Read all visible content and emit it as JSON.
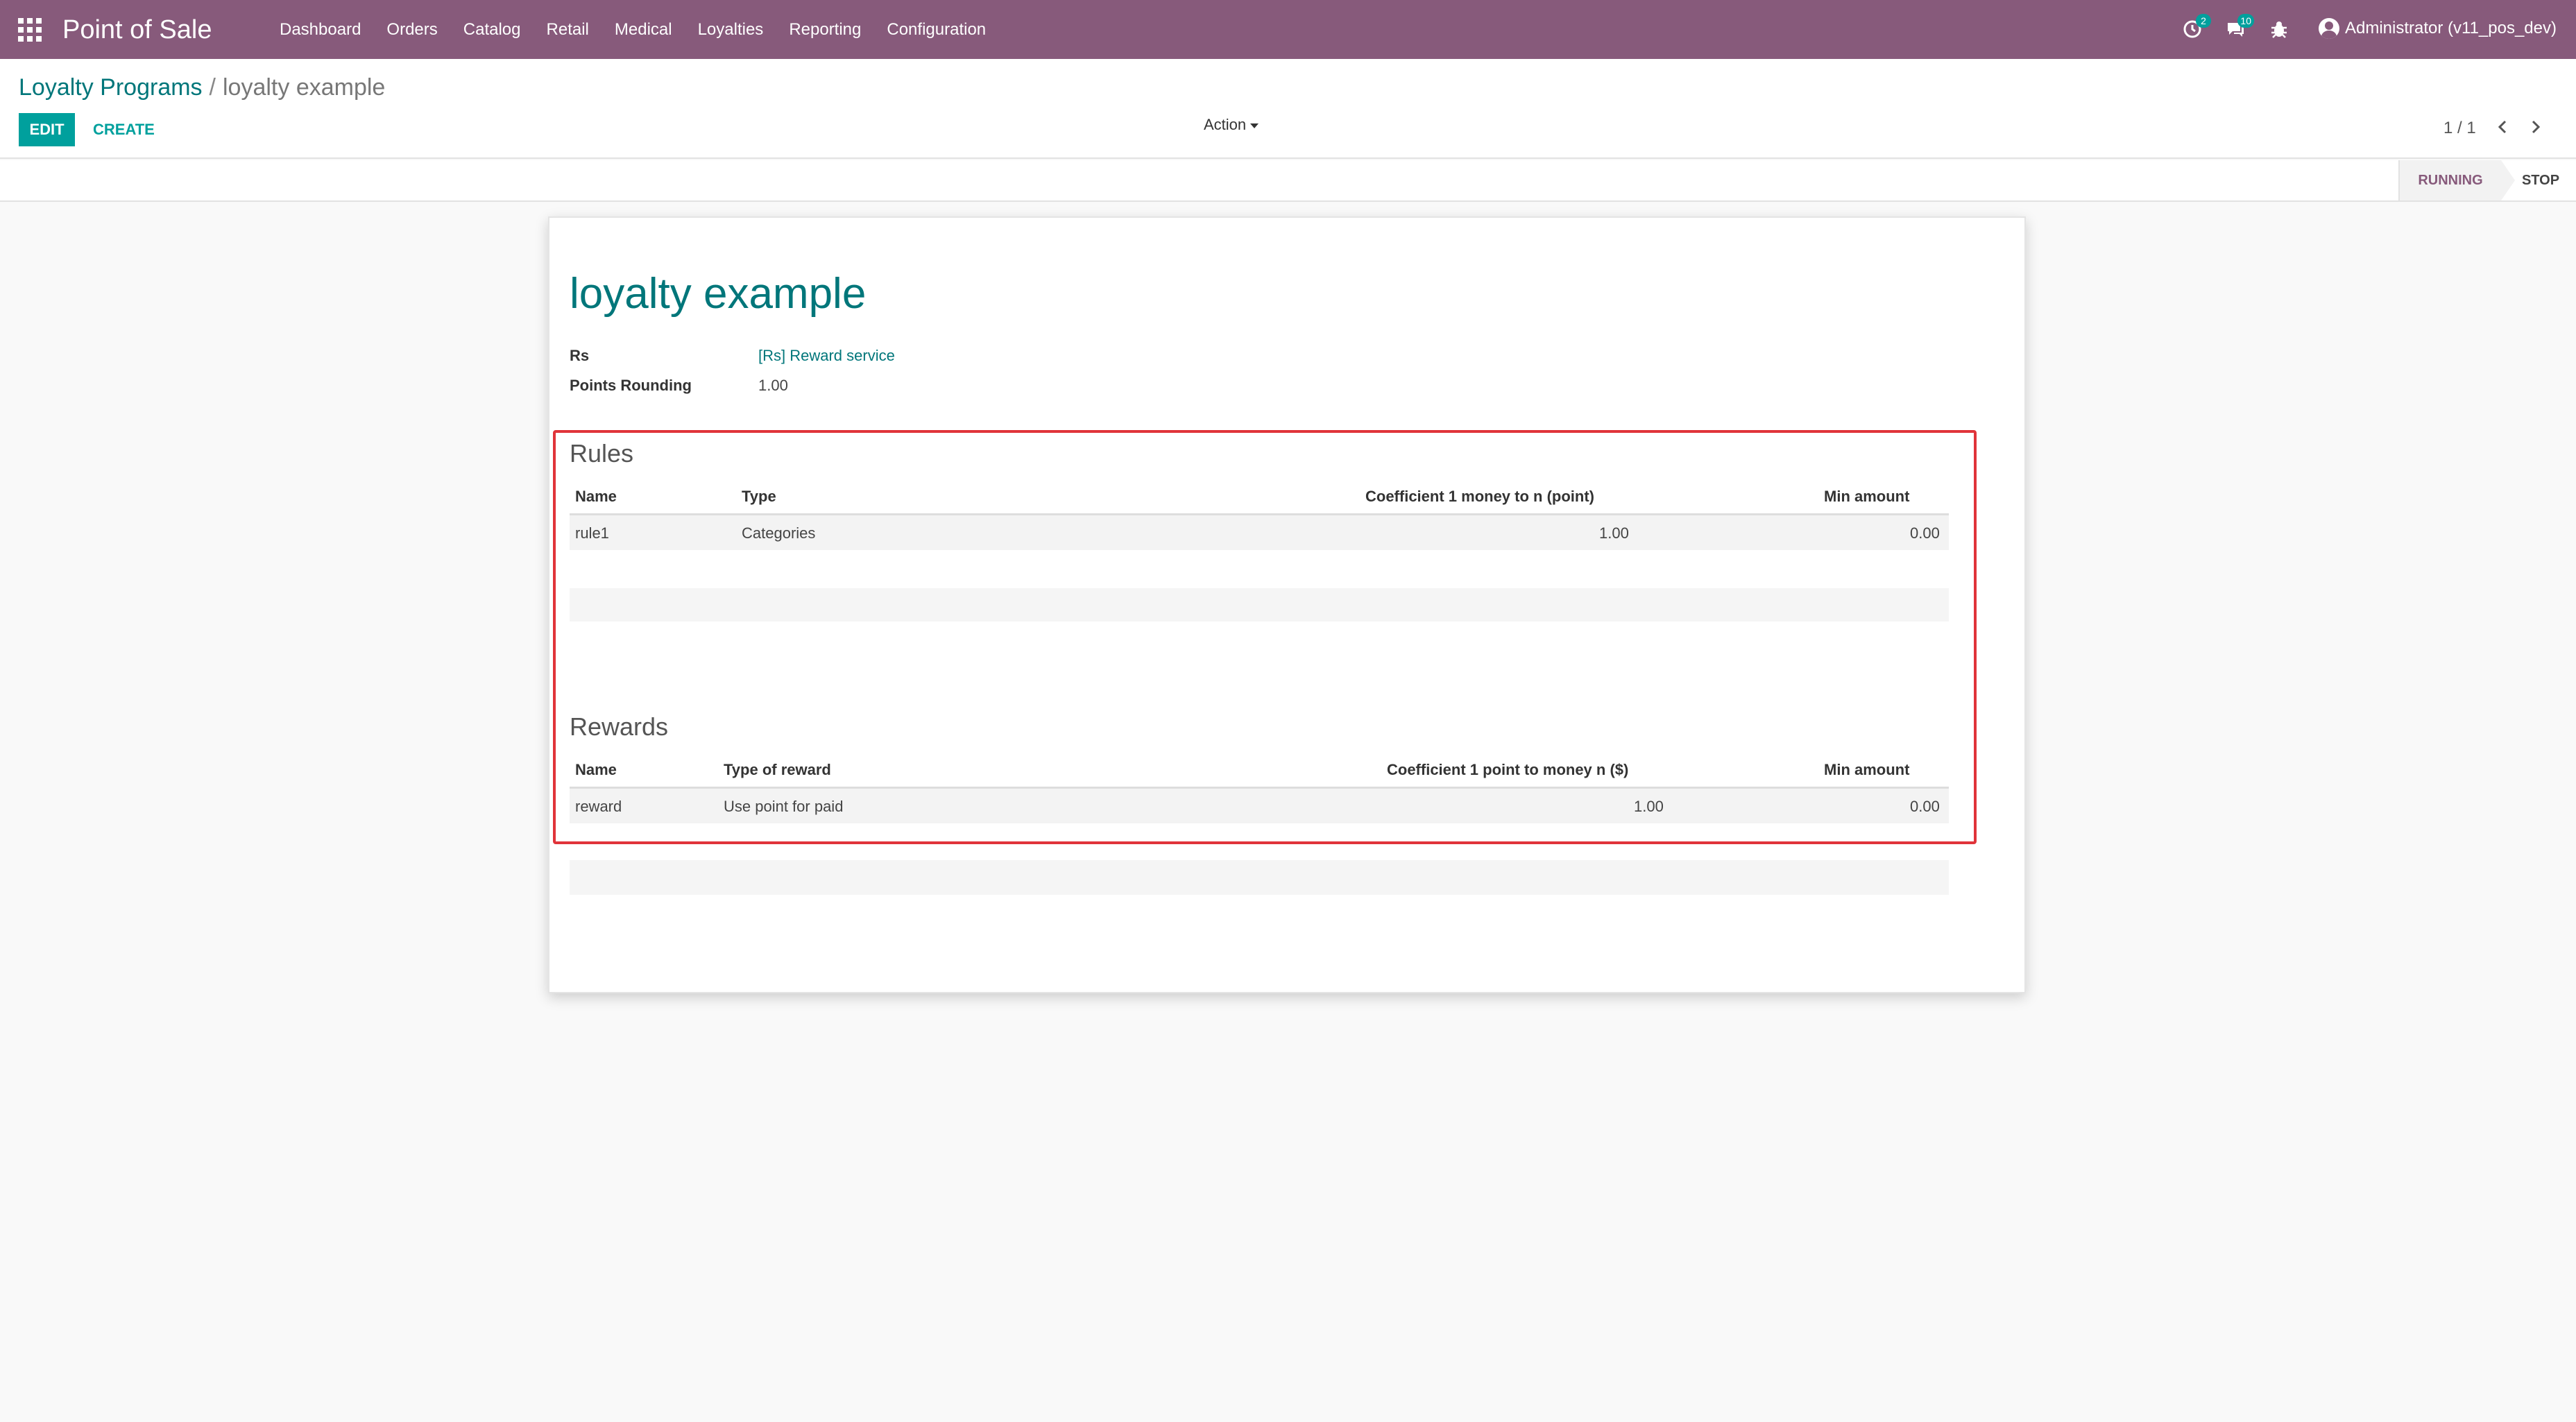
{
  "navbar": {
    "app_title": "Point of Sale",
    "menu": [
      "Dashboard",
      "Orders",
      "Catalog",
      "Retail",
      "Medical",
      "Loyalties",
      "Reporting",
      "Configuration"
    ],
    "activity_badge": "2",
    "messages_badge": "10",
    "user": "Administrator (v11_pos_dev)",
    "icons": [
      "apps-grid-icon",
      "activity-clock-icon",
      "chat-icon",
      "bug-icon",
      "user-avatar-icon"
    ]
  },
  "control_panel": {
    "breadcrumb_parent": "Loyalty Programs",
    "breadcrumb_sep": "/",
    "breadcrumb_current": "loyalty example",
    "edit_label": "EDIT",
    "create_label": "CREATE",
    "action_label": "Action",
    "pager": "1 / 1"
  },
  "statusbar": {
    "active": "RUNNING",
    "other": "STOP"
  },
  "record": {
    "title": "loyalty example",
    "fields": {
      "rs_label": "Rs",
      "rs_value": "[Rs] Reward service",
      "rounding_label": "Points Rounding",
      "rounding_value": "1.00"
    }
  },
  "rules": {
    "title": "Rules",
    "headers": [
      "Name",
      "Type",
      "Coefficient 1 money to n (point)",
      "Min amount"
    ],
    "rows": [
      {
        "name": "rule1",
        "type": "Categories",
        "coefficient": "1.00",
        "min_amount": "0.00"
      }
    ]
  },
  "rewards": {
    "title": "Rewards",
    "headers": [
      "Name",
      "Type of reward",
      "Coefficient 1 point to money n ($)",
      "Min amount"
    ],
    "rows": [
      {
        "name": "reward",
        "type": "Use point for paid",
        "coefficient": "1.00",
        "min_amount": "0.00"
      }
    ]
  },
  "colors": {
    "navbar": "#875a7b",
    "accent": "#00a09d",
    "link": "#00767a",
    "highlight": "#e0343a"
  }
}
